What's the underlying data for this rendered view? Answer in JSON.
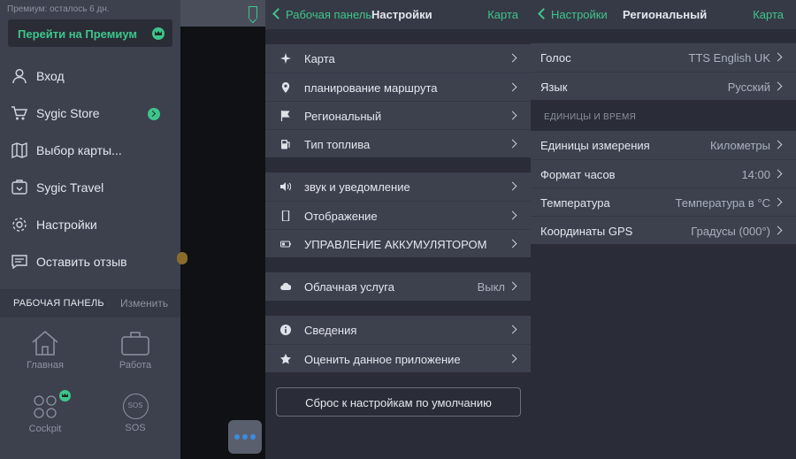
{
  "panel1": {
    "trial_text": "Премиум: осталось 6 дн.",
    "premium_button": "Перейти на Премиум",
    "menu": [
      {
        "label": "Вход",
        "icon": "user-icon"
      },
      {
        "label": "Sygic Store",
        "icon": "cart-icon"
      },
      {
        "label": "Выбор карты...",
        "icon": "map-icon"
      },
      {
        "label": "Sygic Travel",
        "icon": "travel-icon"
      },
      {
        "label": "Настройки",
        "icon": "gear-icon"
      },
      {
        "label": "Оставить отзыв",
        "icon": "feedback-icon"
      }
    ],
    "dashboard": {
      "title": "РАБОЧАЯ ПАНЕЛЬ",
      "edit": "Изменить",
      "tiles": [
        {
          "label": "Главная",
          "icon": "home-icon"
        },
        {
          "label": "Работа",
          "icon": "briefcase-icon"
        },
        {
          "label": "Cockpit",
          "icon": "cockpit-icon"
        },
        {
          "label": "SOS",
          "icon": "sos-icon"
        }
      ],
      "sos_glyph": "SOS"
    },
    "accent_color": "#3ec58c"
  },
  "panel2": {
    "nav": {
      "back": "Рабочая панель",
      "title": "Настройки",
      "right": "Карта"
    },
    "groups": [
      [
        {
          "label": "Карта",
          "icon": "compass-icon"
        },
        {
          "label": "планирование маршрута",
          "icon": "pin-icon"
        },
        {
          "label": "Региональный",
          "icon": "flag-icon"
        },
        {
          "label": "Тип топлива",
          "icon": "fuel-icon"
        }
      ],
      [
        {
          "label": "звук и уведомление",
          "icon": "speaker-icon"
        },
        {
          "label": "Отображение",
          "icon": "phone-icon"
        },
        {
          "label": "УПРАВЛЕНИЕ АККУМУЛЯТОРОМ",
          "icon": "battery-icon"
        }
      ],
      [
        {
          "label": "Облачная услуга",
          "value": "Выкл",
          "icon": "cloud-icon"
        }
      ],
      [
        {
          "label": "Сведения",
          "icon": "info-icon"
        },
        {
          "label": "Оценить данное приложение",
          "icon": "star-icon"
        }
      ]
    ],
    "reset_button": "Сброс к настройкам по умолчанию"
  },
  "panel3": {
    "nav": {
      "back": "Настройки",
      "title": "Региональный",
      "right": "Карта"
    },
    "group1": [
      {
        "label": "Голос",
        "value": "TTS English UK"
      },
      {
        "label": "Язык",
        "value": "Русский"
      }
    ],
    "section_title": "ЕДИНИЦЫ И ВРЕМЯ",
    "group2": [
      {
        "label": "Единицы измерения",
        "value": "Километры"
      },
      {
        "label": "Формат часов",
        "value": "14:00"
      },
      {
        "label": "Температура",
        "value": "Температура в °C"
      },
      {
        "label": "Координаты GPS",
        "value": "Градусы (000°)"
      }
    ]
  }
}
